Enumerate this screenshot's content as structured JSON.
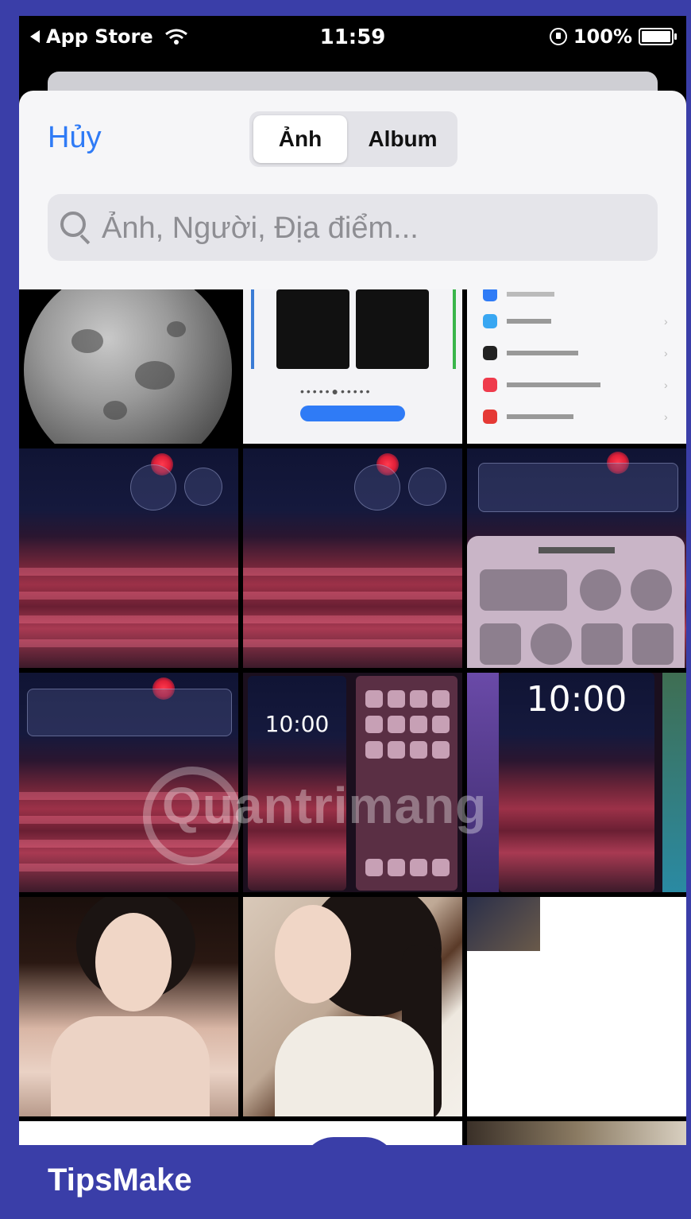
{
  "status_bar": {
    "back_app": "App Store",
    "time": "11:59",
    "battery": "100%",
    "icons": [
      "back-triangle-icon",
      "wifi-icon",
      "orientation-lock-icon",
      "battery-icon"
    ]
  },
  "picker": {
    "cancel_label": "Hủy",
    "tabs": [
      {
        "label": "Ảnh",
        "selected": true
      },
      {
        "label": "Album",
        "selected": false
      }
    ],
    "search": {
      "placeholder": "Ảnh, Người, Địa điểm...",
      "icon": "search-icon"
    }
  },
  "grid": {
    "photos": [
      {
        "name": "photo-moon"
      },
      {
        "name": "photo-wallpaper-screenshot"
      },
      {
        "name": "photo-settings-screenshot"
      },
      {
        "name": "photo-street-1"
      },
      {
        "name": "photo-street-2"
      },
      {
        "name": "photo-add-widget"
      },
      {
        "name": "photo-street-3"
      },
      {
        "name": "photo-lockscreen-homescreen"
      },
      {
        "name": "photo-lockscreen"
      },
      {
        "name": "photo-portrait-1"
      },
      {
        "name": "photo-portrait-2"
      },
      {
        "name": "photo-partial"
      }
    ],
    "lockscreen_clock": "10:00"
  },
  "watermark": {
    "text": "Quantrimang"
  },
  "brand": {
    "text": "TipsMake"
  },
  "colors": {
    "accent": "#2f7bf6",
    "border": "#3a3ea8",
    "sheet_bg": "#f6f6f8"
  }
}
